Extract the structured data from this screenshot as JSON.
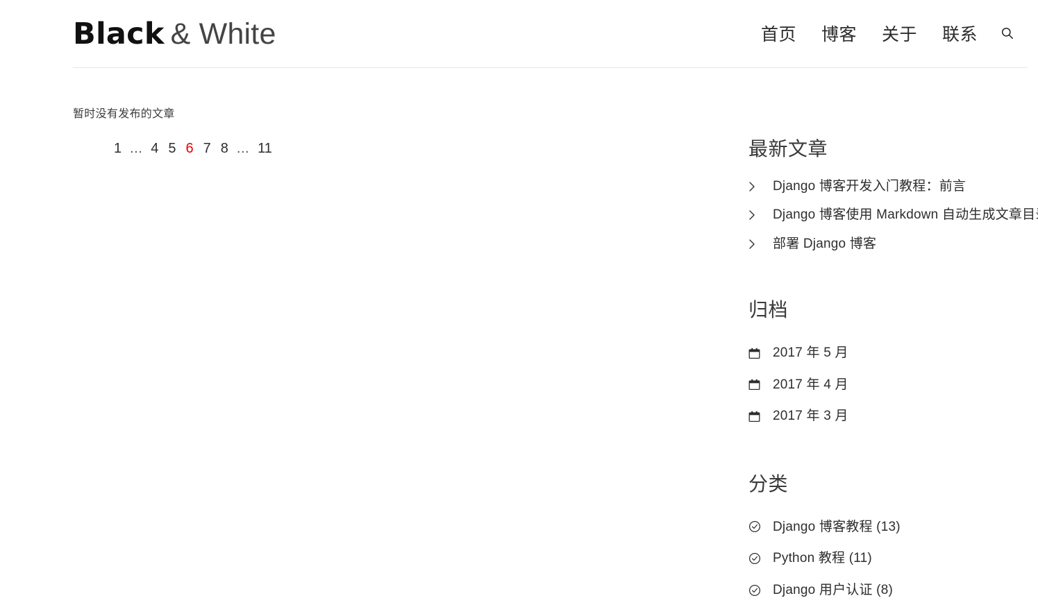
{
  "site": {
    "logo_strong": "Black",
    "logo_light": "& White"
  },
  "nav": {
    "items": [
      {
        "label": "首页",
        "name": "nav-item-home"
      },
      {
        "label": "博客",
        "name": "nav-item-blog"
      },
      {
        "label": "关于",
        "name": "nav-item-about"
      },
      {
        "label": "联系",
        "name": "nav-item-contact"
      }
    ],
    "search_icon": "search-icon"
  },
  "main": {
    "empty_message": "暂时没有发布的文章",
    "pagination": {
      "items": [
        {
          "label": "1",
          "type": "page",
          "current": false
        },
        {
          "label": "...",
          "type": "gap",
          "current": false
        },
        {
          "label": "4",
          "type": "page",
          "current": false
        },
        {
          "label": "5",
          "type": "page",
          "current": false
        },
        {
          "label": "6",
          "type": "page",
          "current": true
        },
        {
          "label": "7",
          "type": "page",
          "current": false
        },
        {
          "label": "8",
          "type": "page",
          "current": false
        },
        {
          "label": "...",
          "type": "gap",
          "current": false
        },
        {
          "label": "11",
          "type": "page",
          "current": false
        }
      ],
      "current_page": "6",
      "total_pages": "11",
      "current_color": "#e60000"
    }
  },
  "sidebar": {
    "widgets": [
      {
        "name": "widget-latest-posts",
        "title": "最新文章",
        "icon": "chevron-right-icon",
        "items": [
          {
            "label": "Django 博客开发入门教程：前言"
          },
          {
            "label": "Django 博客使用 Markdown 自动生成文章目录"
          },
          {
            "label": "部署 Django 博客"
          }
        ]
      },
      {
        "name": "widget-archive",
        "title": "归档",
        "icon": "calendar-icon",
        "items": [
          {
            "label": "2017 年 5 月"
          },
          {
            "label": "2017 年 4 月"
          },
          {
            "label": "2017 年 3 月"
          }
        ]
      },
      {
        "name": "widget-category",
        "title": "分类",
        "icon": "circle-check-icon",
        "items": [
          {
            "label": "Django 博客教程 (13)"
          },
          {
            "label": "Python 教程 (11)"
          },
          {
            "label": "Django 用户认证 (8)"
          }
        ]
      }
    ]
  },
  "theme": {
    "text_color": "#2e2e2e",
    "heading_color": "#3a3a3a",
    "rule_color": "#e6e6e6",
    "background": "#ffffff"
  }
}
